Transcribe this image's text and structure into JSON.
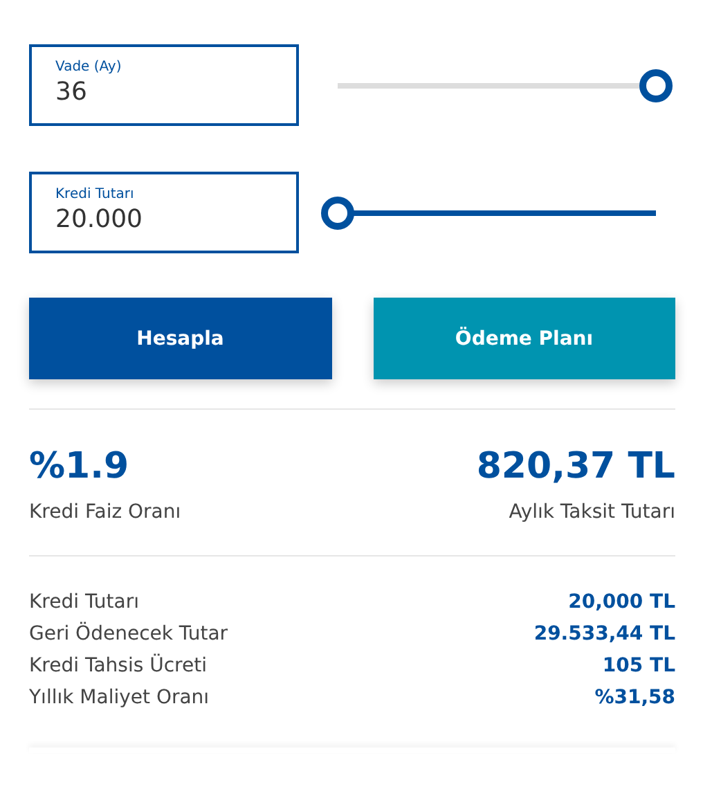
{
  "inputs": [
    {
      "label": "Vade (Ay)",
      "value": "36",
      "level": 1
    },
    {
      "label": "Kredi Tutarı",
      "value": "20.000",
      "level": 0
    }
  ],
  "buttons": [
    {
      "label": "Hesapla",
      "kind": "primary"
    },
    {
      "label": "Ödeme Planı",
      "kind": "secondary"
    }
  ],
  "summary": [
    {
      "value": "%1.9",
      "label": "Kredi Faiz Oranı"
    },
    {
      "value": "820,37 TL",
      "label": "Aylık Taksit Tutarı"
    }
  ],
  "details": [
    {
      "label": "Kredi Tutarı",
      "value": "20,000 TL"
    },
    {
      "label": "Geri Ödenecek Tutar",
      "value": "29.533,44 TL"
    },
    {
      "label": "Kredi Tahsis Ücreti",
      "value": "105 TL"
    },
    {
      "label": "Yıllık Maliyet Oranı",
      "value": "%31,58"
    }
  ]
}
